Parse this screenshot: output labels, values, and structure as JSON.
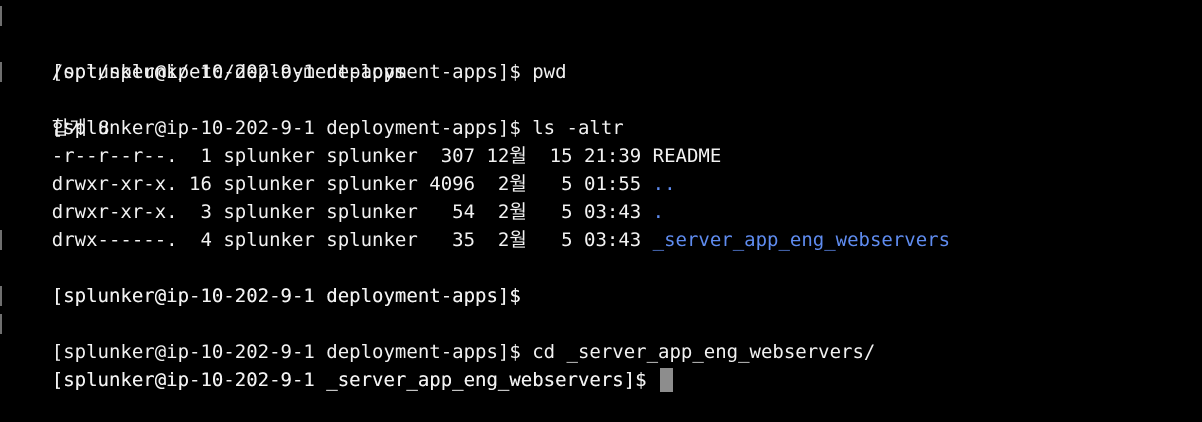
{
  "terminal": {
    "lines": {
      "l0": "[splunker@ip-10-202-9-1 deployment-apps]$ pwd",
      "l1": "/opt/splunk/etc/deployment-apps",
      "l2": "[splunker@ip-10-202-9-1 deployment-apps]$ ls -altr",
      "l3": "합계 8",
      "l4": "-r--r--r--.  1 splunker splunker  307 12월  15 21:39 README",
      "l5": "drwxr-xr-x. 16 splunker splunker 4096  2월   5 01:55 ",
      "l5_name": "..",
      "l6": "drwxr-xr-x.  3 splunker splunker   54  2월   5 03:43 ",
      "l6_name": ".",
      "l7": "drwx------.  4 splunker splunker   35  2월   5 03:43 ",
      "l7_name": "_server_app_eng_webservers",
      "l8": "[splunker@ip-10-202-9-1 deployment-apps]$",
      "l9": "[splunker@ip-10-202-9-1 deployment-apps]$",
      "l10": "[splunker@ip-10-202-9-1 deployment-apps]$ cd _server_app_eng_webservers/",
      "l11": "[splunker@ip-10-202-9-1 _server_app_eng_webservers]$",
      "l12": "[splunker@ip-10-202-9-1 _server_app_eng_webservers]$ "
    },
    "colors": {
      "background": "#000000",
      "text": "#f2f2f2",
      "directory": "#5f8cf0",
      "cursor": "#8d8d8d"
    }
  }
}
